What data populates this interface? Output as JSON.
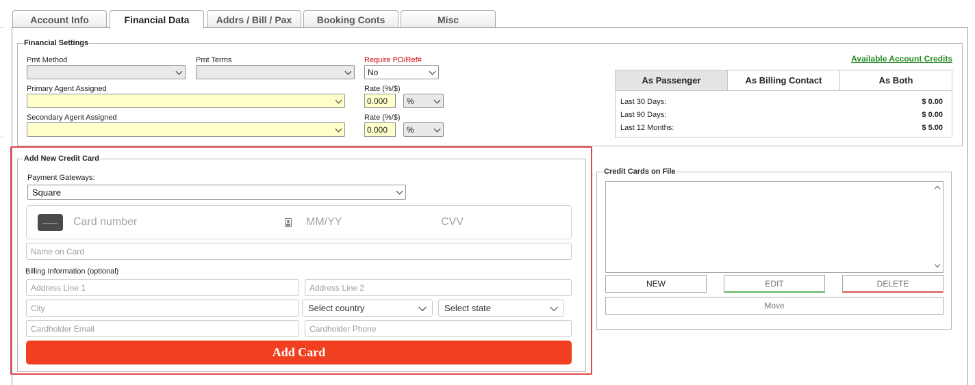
{
  "tabs": [
    {
      "label": "Account Info"
    },
    {
      "label": "Financial Data"
    },
    {
      "label": "Addrs / Bill / Pax"
    },
    {
      "label": "Booking Conts"
    },
    {
      "label": "Misc"
    }
  ],
  "financial_settings": {
    "legend": "Financial Settings",
    "pmt_method_label": "Pmt Method",
    "pmt_method_value": "",
    "pmt_terms_label": "Pmt Terms",
    "pmt_terms_value": "",
    "require_po_label": "Require PO/Ref#",
    "require_po_value": "No",
    "primary_agent_label": "Primary Agent Assigned",
    "primary_agent_value": "",
    "secondary_agent_label": "Secondary Agent Assigned",
    "secondary_agent_value": "",
    "rate_label": "Rate (%/$)",
    "rate1_value": "0.000",
    "rate1_unit": "%",
    "rate2_value": "0.000",
    "rate2_unit": "%"
  },
  "credits": {
    "link": "Available Account Credits",
    "tabs": [
      {
        "label": "As Passenger"
      },
      {
        "label": "As Billing Contact"
      },
      {
        "label": "As Both"
      }
    ],
    "rows": [
      {
        "label": "Last 30 Days:",
        "value": "$ 0.00"
      },
      {
        "label": "Last 90 Days:",
        "value": "$ 0.00"
      },
      {
        "label": "Last 12 Months:",
        "value": "$ 5.00"
      }
    ]
  },
  "add_card": {
    "legend": "Add New Credit Card",
    "gateway_label": "Payment Gateways:",
    "gateway_value": "Square",
    "card_number_placeholder": "Card number",
    "expiry_placeholder": "MM/YY",
    "cvv_placeholder": "CVV",
    "name_placeholder": "Name on Card",
    "billing_label": "Billing Information (optional)",
    "address1_placeholder": "Address Line 1",
    "address2_placeholder": "Address Line 2",
    "city_placeholder": "City",
    "country_placeholder": "Select country",
    "state_placeholder": "Select state",
    "email_placeholder": "Cardholder Email",
    "phone_placeholder": "Cardholder Phone",
    "submit_label": "Add Card",
    "submit_color": "#f0401f"
  },
  "cards_on_file": {
    "legend": "Credit Cards on File",
    "new_label": "NEW",
    "edit_label": "EDIT",
    "delete_label": "DELETE",
    "move_label": "Move"
  },
  "colors": {
    "required_label": "#cc0000",
    "credits_link": "#228b22",
    "highlight_border": "#e0464a",
    "input_yellow": "#ffffcc"
  },
  "icons": {
    "card_icon": "credit-card-icon",
    "autofill_icon": "autofill-contact-icon"
  }
}
